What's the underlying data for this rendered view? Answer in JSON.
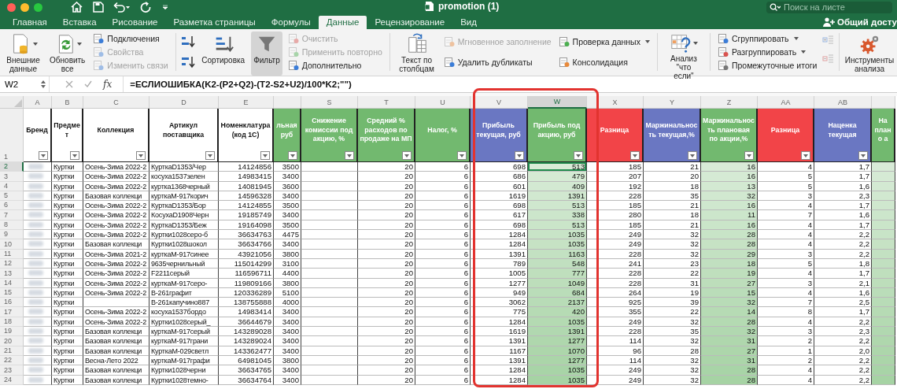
{
  "window": {
    "title": "promotion (1)",
    "search_placeholder": "Поиск на листе",
    "share_label": "Общий досту"
  },
  "tabs": [
    {
      "label": "Главная",
      "selected": false
    },
    {
      "label": "Вставка",
      "selected": false
    },
    {
      "label": "Рисование",
      "selected": false
    },
    {
      "label": "Разметка страницы",
      "selected": false
    },
    {
      "label": "Формулы",
      "selected": false
    },
    {
      "label": "Данные",
      "selected": true
    },
    {
      "label": "Рецензирование",
      "selected": false
    },
    {
      "label": "Вид",
      "selected": false
    }
  ],
  "ribbon": [
    {
      "kind": "large",
      "label": "Внешние данные",
      "dropdown": true,
      "pressed": false
    },
    {
      "kind": "large",
      "label": "Обновить все",
      "dropdown": true,
      "pressed": false
    },
    {
      "kind": "stack",
      "items": [
        {
          "label": "Подключения",
          "disabled": false,
          "dropdown": false
        },
        {
          "label": "Свойства",
          "disabled": true,
          "dropdown": false
        },
        {
          "label": "Изменить связи",
          "disabled": true,
          "dropdown": false
        }
      ]
    },
    {
      "kind": "separator"
    },
    {
      "kind": "sort"
    },
    {
      "kind": "large",
      "label": "Сортировка",
      "dropdown": false,
      "pressed": false
    },
    {
      "kind": "large",
      "label": "Фильтр",
      "dropdown": false,
      "pressed": true
    },
    {
      "kind": "stack",
      "items": [
        {
          "label": "Очистить",
          "disabled": true,
          "dropdown": false
        },
        {
          "label": "Применить повторно",
          "disabled": true,
          "dropdown": false
        },
        {
          "label": "Дополнительно",
          "disabled": false,
          "dropdown": false
        }
      ]
    },
    {
      "kind": "separator"
    },
    {
      "kind": "large",
      "label": "Текст по столбцам",
      "dropdown": false,
      "pressed": false
    },
    {
      "kind": "stack",
      "items": [
        {
          "label": "Мгновенное заполнение",
          "disabled": true,
          "dropdown": false
        },
        {
          "label": "Удалить дубликаты",
          "disabled": false,
          "dropdown": false
        }
      ]
    },
    {
      "kind": "stack",
      "items": [
        {
          "label": "Проверка данных",
          "disabled": false,
          "dropdown": true
        },
        {
          "label": "Консолидация",
          "disabled": false,
          "dropdown": false
        }
      ]
    },
    {
      "kind": "separator"
    },
    {
      "kind": "large",
      "label": "Анализ \"что если\"",
      "dropdown": true,
      "pressed": false
    },
    {
      "kind": "separator"
    },
    {
      "kind": "stack",
      "items": [
        {
          "label": "Сгруппировать",
          "disabled": false,
          "dropdown": true
        },
        {
          "label": "Разгруппировать",
          "disabled": false,
          "dropdown": true
        },
        {
          "label": "Промежуточные итоги",
          "disabled": false,
          "dropdown": false
        }
      ]
    },
    {
      "kind": "outline"
    },
    {
      "kind": "separator"
    },
    {
      "kind": "large",
      "label": "Инструменты анализа",
      "dropdown": false,
      "pressed": false
    }
  ],
  "formula_bar": {
    "cell_ref": "W2",
    "fx_label": "fx",
    "formula": "=ЕСЛИОШИБКА(K2-(P2+Q2)-(T2-S2+U2)/100*K2;\"\")"
  },
  "table": {
    "header_row_number": "1",
    "columns": [
      {
        "letter": "A",
        "header": "Бренд",
        "color": "#ffffff",
        "selected": false,
        "redacted": true,
        "shaded": false,
        "filter": true
      },
      {
        "letter": "B",
        "header": "Предмет",
        "color": "#ffffff",
        "selected": false,
        "redacted": false,
        "shaded": false,
        "filter": true
      },
      {
        "letter": "C",
        "header": "Коллекция",
        "color": "#ffffff",
        "selected": false,
        "redacted": false,
        "shaded": false,
        "filter": true
      },
      {
        "letter": "D",
        "header": "Артикул поставщика",
        "color": "#ffffff",
        "selected": false,
        "redacted": false,
        "shaded": false,
        "filter": true
      },
      {
        "letter": "E",
        "header": "Номенклатура (код 1С)",
        "color": "#ffffff",
        "selected": false,
        "redacted": false,
        "shaded": false,
        "filter": true
      },
      {
        "header": "льная руб",
        "color": "#72b96f",
        "selected": false,
        "redacted": false,
        "shaded": false,
        "filter": true
      },
      {
        "letter": "S",
        "header": "Снижение комиссии под акцию, %",
        "color": "#72b96f",
        "selected": false,
        "redacted": false,
        "shaded": false,
        "filter": true
      },
      {
        "letter": "T",
        "header": "Средний % расходов по продаже на МП",
        "color": "#72b96f",
        "selected": false,
        "redacted": false,
        "shaded": false,
        "filter": true
      },
      {
        "letter": "U",
        "header": "Налог, %",
        "color": "#72b96f",
        "selected": false,
        "redacted": false,
        "shaded": false,
        "filter": true
      },
      {
        "letter": "V",
        "header": "Прибыль текущая, руб",
        "color": "#6a77c2",
        "selected": false,
        "redacted": false,
        "shaded": false,
        "filter": true
      },
      {
        "letter": "W",
        "header": "Прибыль под акцию, руб",
        "color": "#72b96f",
        "selected": true,
        "redacted": false,
        "shaded": true,
        "filter": true
      },
      {
        "letter": "X",
        "header": "Разница",
        "color": "#f24448",
        "selected": false,
        "redacted": false,
        "shaded": false,
        "filter": true
      },
      {
        "letter": "Y",
        "header": "Маржинальность текущая,%",
        "color": "#6a77c2",
        "selected": false,
        "redacted": false,
        "shaded": false,
        "filter": true
      },
      {
        "letter": "Z",
        "header": "Маржинальность плановая по акции,%",
        "color": "#72b96f",
        "selected": false,
        "redacted": false,
        "shaded": true,
        "filter": true
      },
      {
        "letter": "AA",
        "header": "Разница",
        "color": "#f24448",
        "selected": false,
        "redacted": false,
        "shaded": false,
        "filter": true
      },
      {
        "letter": "AB",
        "header": "Наценка текущая",
        "color": "#6a77c2",
        "selected": false,
        "redacted": false,
        "shaded": false,
        "filter": true
      },
      {
        "header": "На плано а",
        "color": "#72b96f",
        "selected": false,
        "redacted": false,
        "shaded": true,
        "filter": false
      }
    ],
    "rows": [
      {
        "number": "2",
        "selected": true,
        "cells": [
          null,
          "Куртки",
          "Осень-Зима 2022-2",
          "КурткаD1353/Чер",
          "14124856",
          "3500",
          null,
          "20",
          "6",
          "698",
          "513",
          "185",
          "21",
          "16",
          "4",
          "1,7",
          null
        ]
      },
      {
        "number": "3",
        "selected": false,
        "cells": [
          null,
          "Куртки",
          "Осень-Зима 2022-2",
          "косуха1537зелен",
          "14983415",
          "3400",
          null,
          "20",
          "6",
          "686",
          "479",
          "207",
          "20",
          "16",
          "5",
          "1,7",
          null
        ]
      },
      {
        "number": "4",
        "selected": false,
        "cells": [
          null,
          "Куртки",
          "Осень-Зима 2022-2",
          "куртка1368черный",
          "14081945",
          "3600",
          null,
          "20",
          "6",
          "601",
          "409",
          "192",
          "18",
          "13",
          "5",
          "1,6",
          null
        ]
      },
      {
        "number": "5",
        "selected": false,
        "cells": [
          null,
          "Куртки",
          "Базовая коллекци",
          "курткаM-917корич",
          "14596328",
          "3400",
          null,
          "20",
          "6",
          "1619",
          "1391",
          "228",
          "35",
          "32",
          "3",
          "2,3",
          null
        ]
      },
      {
        "number": "6",
        "selected": false,
        "cells": [
          null,
          "Куртки",
          "Осень-Зима 2022-2",
          "КурткаD1353/Бор",
          "14124855",
          "3500",
          null,
          "20",
          "6",
          "698",
          "513",
          "185",
          "21",
          "16",
          "4",
          "1,7",
          null
        ]
      },
      {
        "number": "7",
        "selected": false,
        "cells": [
          null,
          "Куртки",
          "Осень-Зима 2022-2",
          "КосухаD1908Черн",
          "19185749",
          "3400",
          null,
          "20",
          "6",
          "617",
          "338",
          "280",
          "18",
          "11",
          "7",
          "1,6",
          null
        ]
      },
      {
        "number": "8",
        "selected": false,
        "cells": [
          null,
          "Куртки",
          "Осень-Зима 2022-2",
          "КурткаD1353/Беж",
          "19164098",
          "3500",
          null,
          "20",
          "6",
          "698",
          "513",
          "185",
          "21",
          "16",
          "4",
          "1,7",
          null
        ]
      },
      {
        "number": "9",
        "selected": false,
        "cells": [
          null,
          "Куртки",
          "Осень-Зима 2022-2",
          "Куртки1028серо-б",
          "36634763",
          "4475",
          null,
          "20",
          "6",
          "1284",
          "1035",
          "249",
          "32",
          "28",
          "4",
          "2,2",
          null
        ]
      },
      {
        "number": "10",
        "selected": false,
        "cells": [
          null,
          "Куртки",
          "Базовая коллекци",
          "Куртки1028шокол",
          "36634766",
          "3400",
          null,
          "20",
          "6",
          "1284",
          "1035",
          "249",
          "32",
          "28",
          "4",
          "2,2",
          null
        ]
      },
      {
        "number": "11",
        "selected": false,
        "cells": [
          null,
          "Куртки",
          "Осень-Зима 2021-2",
          "курткаM-917синее",
          "43921056",
          "3800",
          null,
          "20",
          "6",
          "1391",
          "1163",
          "228",
          "32",
          "29",
          "3",
          "2,2",
          null
        ]
      },
      {
        "number": "12",
        "selected": false,
        "cells": [
          null,
          "Куртки",
          "Осень-Зима 2022-2",
          "9635чернильный",
          "115014299",
          "3100",
          null,
          "20",
          "6",
          "789",
          "548",
          "241",
          "23",
          "18",
          "5",
          "1,8",
          null
        ]
      },
      {
        "number": "13",
        "selected": false,
        "cells": [
          null,
          "Куртки",
          "Осень-Зима 2022-2",
          "F2211серый",
          "116596711",
          "4400",
          null,
          "20",
          "6",
          "1005",
          "777",
          "228",
          "22",
          "19",
          "4",
          "1,7",
          null
        ]
      },
      {
        "number": "14",
        "selected": false,
        "cells": [
          null,
          "Куртки",
          "Осень-Зима 2022-2",
          "курткаM-917серо-",
          "119809166",
          "3800",
          null,
          "20",
          "6",
          "1277",
          "1049",
          "228",
          "31",
          "27",
          "3",
          "2,1",
          null
        ]
      },
      {
        "number": "15",
        "selected": false,
        "cells": [
          null,
          "Куртки",
          "Осень-Зима 2022-2",
          "B-261графит",
          "120336289",
          "5100",
          null,
          "20",
          "6",
          "949",
          "684",
          "264",
          "19",
          "15",
          "4",
          "1,6",
          null
        ]
      },
      {
        "number": "16",
        "selected": false,
        "cells": [
          null,
          "Куртки",
          null,
          "B-261капучино887",
          "138755888",
          "4000",
          null,
          "20",
          "6",
          "3062",
          "2137",
          "925",
          "39",
          "32",
          "7",
          "2,5",
          null
        ]
      },
      {
        "number": "17",
        "selected": false,
        "cells": [
          null,
          "Куртки",
          "Осень-Зима 2022-2",
          "косуха1537бордо",
          "14983414",
          "3400",
          null,
          "20",
          "6",
          "775",
          "420",
          "355",
          "22",
          "14",
          "8",
          "1,7",
          null
        ]
      },
      {
        "number": "18",
        "selected": false,
        "cells": [
          null,
          "Куртки",
          "Осень-Зима 2022-2",
          "Куртки1028серый_",
          "36644679",
          "3400",
          null,
          "20",
          "6",
          "1284",
          "1035",
          "249",
          "32",
          "28",
          "4",
          "2,2",
          null
        ]
      },
      {
        "number": "19",
        "selected": false,
        "cells": [
          null,
          "Куртки",
          "Базовая коллекци",
          "курткаM-917серый",
          "143289028",
          "3400",
          null,
          "20",
          "6",
          "1619",
          "1391",
          "228",
          "35",
          "32",
          "3",
          "2,3",
          null
        ]
      },
      {
        "number": "20",
        "selected": false,
        "cells": [
          null,
          "Куртки",
          "Базовая коллекци",
          "курткаM-917грани",
          "143289024",
          "3400",
          null,
          "20",
          "6",
          "1391",
          "1277",
          "114",
          "32",
          "31",
          "2",
          "2,2",
          null
        ]
      },
      {
        "number": "21",
        "selected": false,
        "cells": [
          null,
          "Куртки",
          "Базовая коллекци",
          "КурткаM-029светл",
          "143362477",
          "3400",
          null,
          "20",
          "6",
          "1167",
          "1070",
          "96",
          "28",
          "27",
          "1",
          "2,0",
          null
        ]
      },
      {
        "number": "22",
        "selected": false,
        "cells": [
          null,
          "Куртки",
          "Весна-Лето 2022",
          "курткаM-917графи",
          "64981045",
          "3800",
          null,
          "20",
          "6",
          "1391",
          "1277",
          "114",
          "32",
          "31",
          "2",
          "2,2",
          null
        ]
      },
      {
        "number": "23",
        "selected": false,
        "cells": [
          null,
          "Куртки",
          "Базовая коллекци",
          "Куртки1028черни",
          "36634765",
          "3400",
          null,
          "20",
          "6",
          "1284",
          "1035",
          "249",
          "32",
          "28",
          "4",
          "2,2",
          null
        ]
      },
      {
        "number": "24",
        "selected": false,
        "cells": [
          null,
          "Куртки",
          "Базовая коллекци",
          "Куртки1028темно-",
          "36634764",
          "3400",
          null,
          "20",
          "6",
          "1284",
          "1035",
          "249",
          "32",
          "28",
          "4",
          "2,2",
          null
        ]
      }
    ]
  }
}
